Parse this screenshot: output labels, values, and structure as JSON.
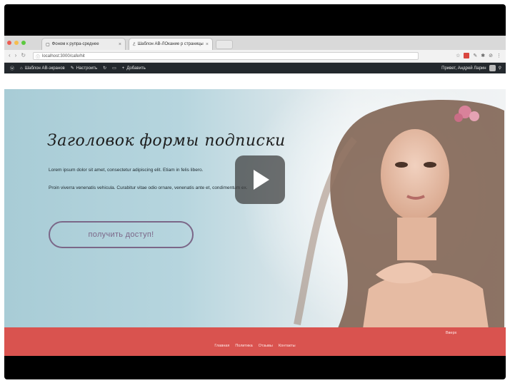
{
  "browser": {
    "tabs": [
      {
        "label": "Фоном к рупра-среднее",
        "active": false
      },
      {
        "label": "Шаблон AB-ЛОкание р страницы",
        "active": true
      }
    ],
    "url": "localhost:3000/cafe/hit",
    "traffic_lights": [
      "#ee5c52",
      "#f5be4f",
      "#5cc93f"
    ]
  },
  "adminbar": {
    "items": [
      "Шаблон AB-экранов",
      "Настроить",
      "Добавить"
    ],
    "user": "Привет, Андрей Ларин"
  },
  "hero": {
    "title": "Заголовок формы подписки",
    "paragraph1": "Lorem ipsum dolor sit amet, consectetur adipiscing elit. Etiam in felis libero.",
    "paragraph2": "Proin viverra venenatis vehicula. Curabitur vitae odio ornare, venenatis ante et, condimentum ex.",
    "cta_label": "получить доступ!"
  },
  "footer": {
    "nav": [
      "Главная",
      "Политика",
      "Отзывы",
      "Контакты"
    ],
    "right_link": "Вверх",
    "color": "#d9534f"
  }
}
